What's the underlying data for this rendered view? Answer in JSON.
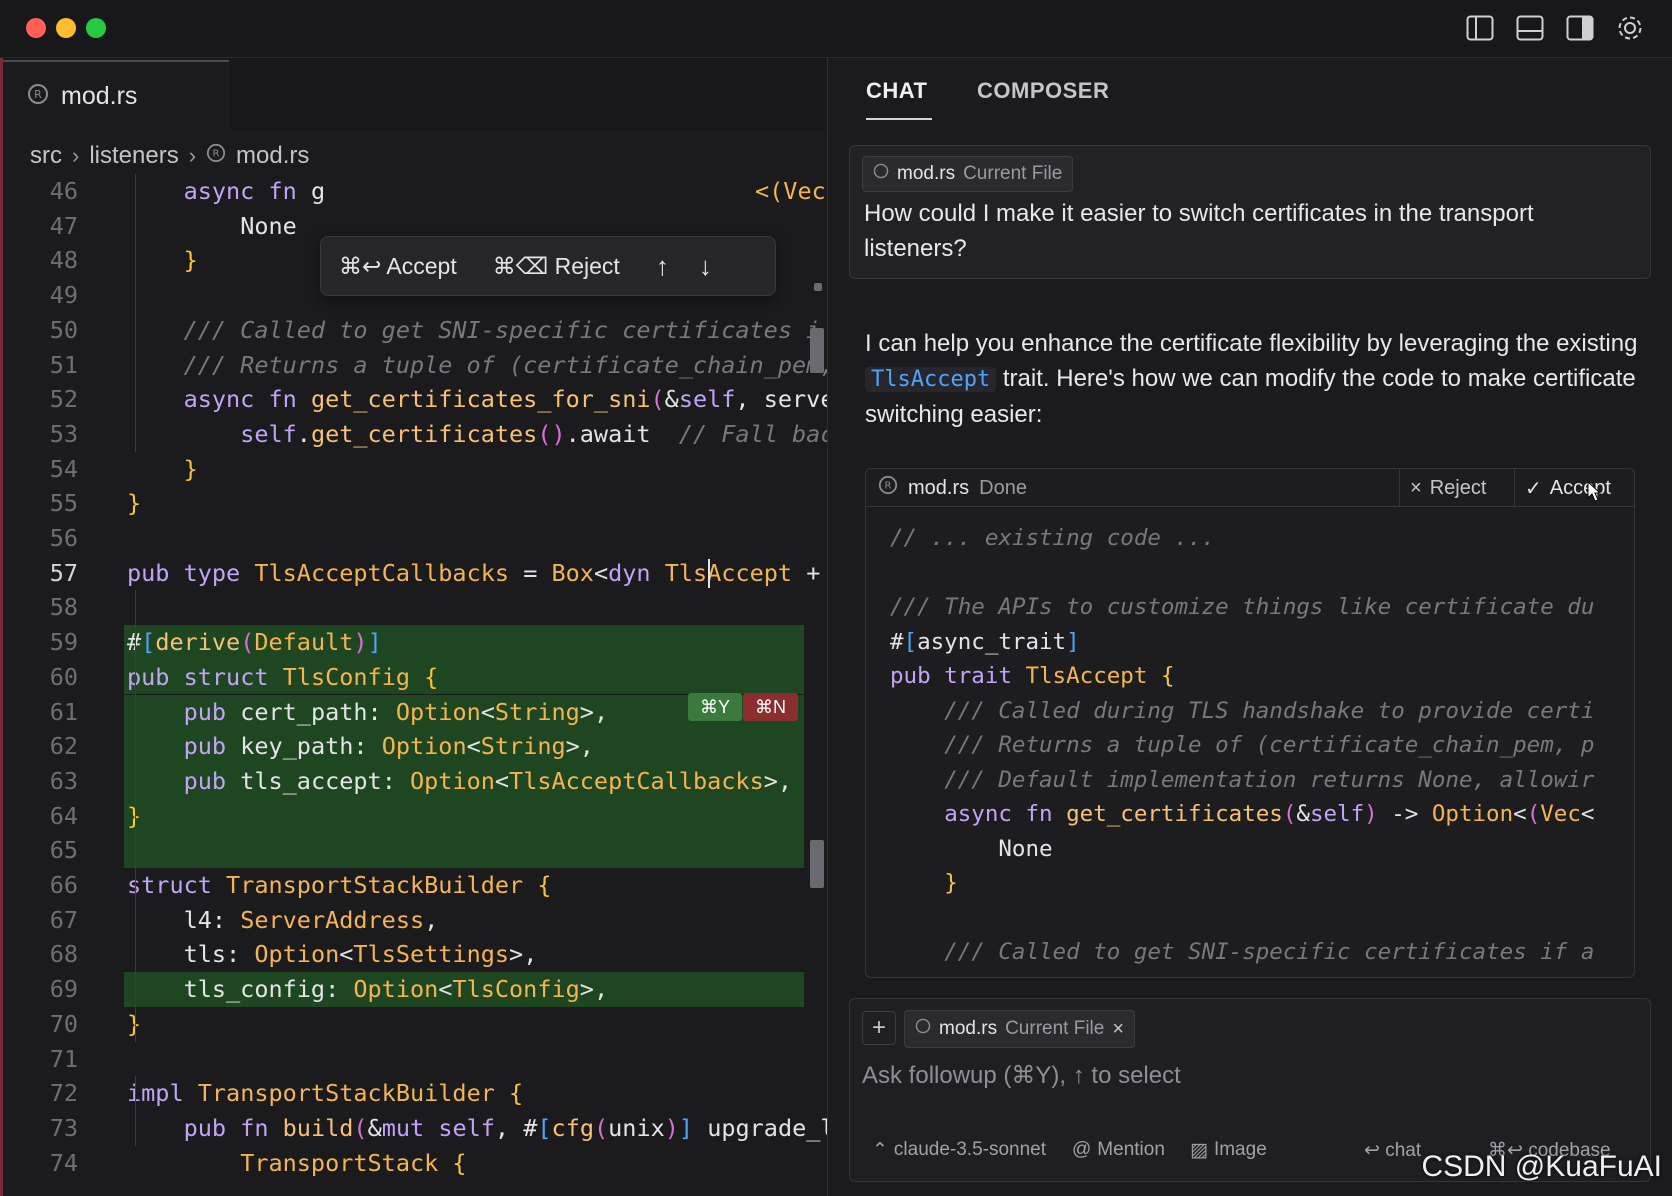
{
  "window": {
    "controls": [
      "close",
      "minimize",
      "maximize"
    ]
  },
  "toolbar_icons": [
    "sidebar-left-icon",
    "panel-bottom-icon",
    "sidebar-right-icon",
    "gear-icon"
  ],
  "editor": {
    "tab_label": "mod.rs",
    "breadcrumb": [
      "src",
      "listeners",
      "mod.rs"
    ],
    "accept_bar": {
      "accept": "⌘↩ Accept",
      "reject": "⌘⌫ Reject"
    },
    "diff_pills": {
      "yes": "⌘Y",
      "no": "⌘N"
    },
    "lines": [
      {
        "n": "46",
        "code": "    async fn g"
      },
      {
        "n": "47",
        "code": "        None"
      },
      {
        "n": "48",
        "code": "    }"
      },
      {
        "n": "49",
        "code": ""
      },
      {
        "n": "50",
        "code": "    /// Called to get SNI-specific certificates i"
      },
      {
        "n": "51",
        "code": "    /// Returns a tuple of (certificate_chain_pem,"
      },
      {
        "n": "52",
        "code": "    async fn get_certificates_for_sni(&self, serve"
      },
      {
        "n": "53",
        "code": "        self.get_certificates().await  // Fall back"
      },
      {
        "n": "54",
        "code": "    }"
      },
      {
        "n": "55",
        "code": "}"
      },
      {
        "n": "56",
        "code": ""
      },
      {
        "n": "57",
        "code": "pub type TlsAcceptCallbacks = Box<dyn TlsAccept + S"
      },
      {
        "n": "58",
        "code": ""
      },
      {
        "n": "59",
        "code": "#[derive(Default)]"
      },
      {
        "n": "60",
        "code": "pub struct TlsConfig {"
      },
      {
        "n": "61",
        "code": "    pub cert_path: Option<String>,"
      },
      {
        "n": "62",
        "code": "    pub key_path: Option<String>,"
      },
      {
        "n": "63",
        "code": "    pub tls_accept: Option<TlsAcceptCallbacks>,"
      },
      {
        "n": "64",
        "code": "}"
      },
      {
        "n": "65",
        "code": ""
      },
      {
        "n": "66",
        "code": "struct TransportStackBuilder {"
      },
      {
        "n": "67",
        "code": "    l4: ServerAddress,"
      },
      {
        "n": "68",
        "code": "    tls: Option<TlsSettings>,"
      },
      {
        "n": "69",
        "code": "    tls_config: Option<TlsConfig>,"
      },
      {
        "n": "70",
        "code": "}"
      },
      {
        "n": "71",
        "code": ""
      },
      {
        "n": "72",
        "code": "impl TransportStackBuilder {"
      },
      {
        "n": "73",
        "code": "    pub fn build(&mut self, #[cfg(unix)] upgrade_l"
      },
      {
        "n": "74",
        "code": "        TransportStack {"
      }
    ],
    "line46_tail": "<(Vec",
    "current_line": "57"
  },
  "chat": {
    "tabs": [
      "CHAT",
      "COMPOSER"
    ],
    "question": {
      "file": "mod.rs",
      "file_sub": "Current File",
      "text": "How could I make it easier to switch certificates in the transport listeners?"
    },
    "answer": {
      "before": "I can help you enhance the certificate flexibility by leveraging the existing ",
      "code": "TlsAccept",
      "after": " trait. Here's how we can modify the code to make certificate switching easier:"
    },
    "codeblock": {
      "file": "mod.rs",
      "status": "Done",
      "reject": "Reject",
      "accept": "Accept",
      "lines": [
        "// ... existing code ...",
        "",
        "/// The APIs to customize things like certificate du",
        "#[async_trait]",
        "pub trait TlsAccept {",
        "    /// Called during TLS handshake to provide certi",
        "    /// Returns a tuple of (certificate_chain_pem, p",
        "    /// Default implementation returns None, allowir",
        "    async fn get_certificates(&self) -> Option<(Vec<",
        "        None",
        "    }",
        "",
        "    /// Called to get SNI-specific certificates if a"
      ]
    },
    "input": {
      "file": "mod.rs",
      "file_sub": "Current File",
      "placeholder": "Ask followup (⌘Y), ↑ to select",
      "model": "claude-3.5-sonnet",
      "mention": "Mention",
      "image": "Image",
      "chat_hint": "↩ chat",
      "codebase_hint": "⌘↩ codebase"
    }
  },
  "watermark": "CSDN @KuaFuAI"
}
